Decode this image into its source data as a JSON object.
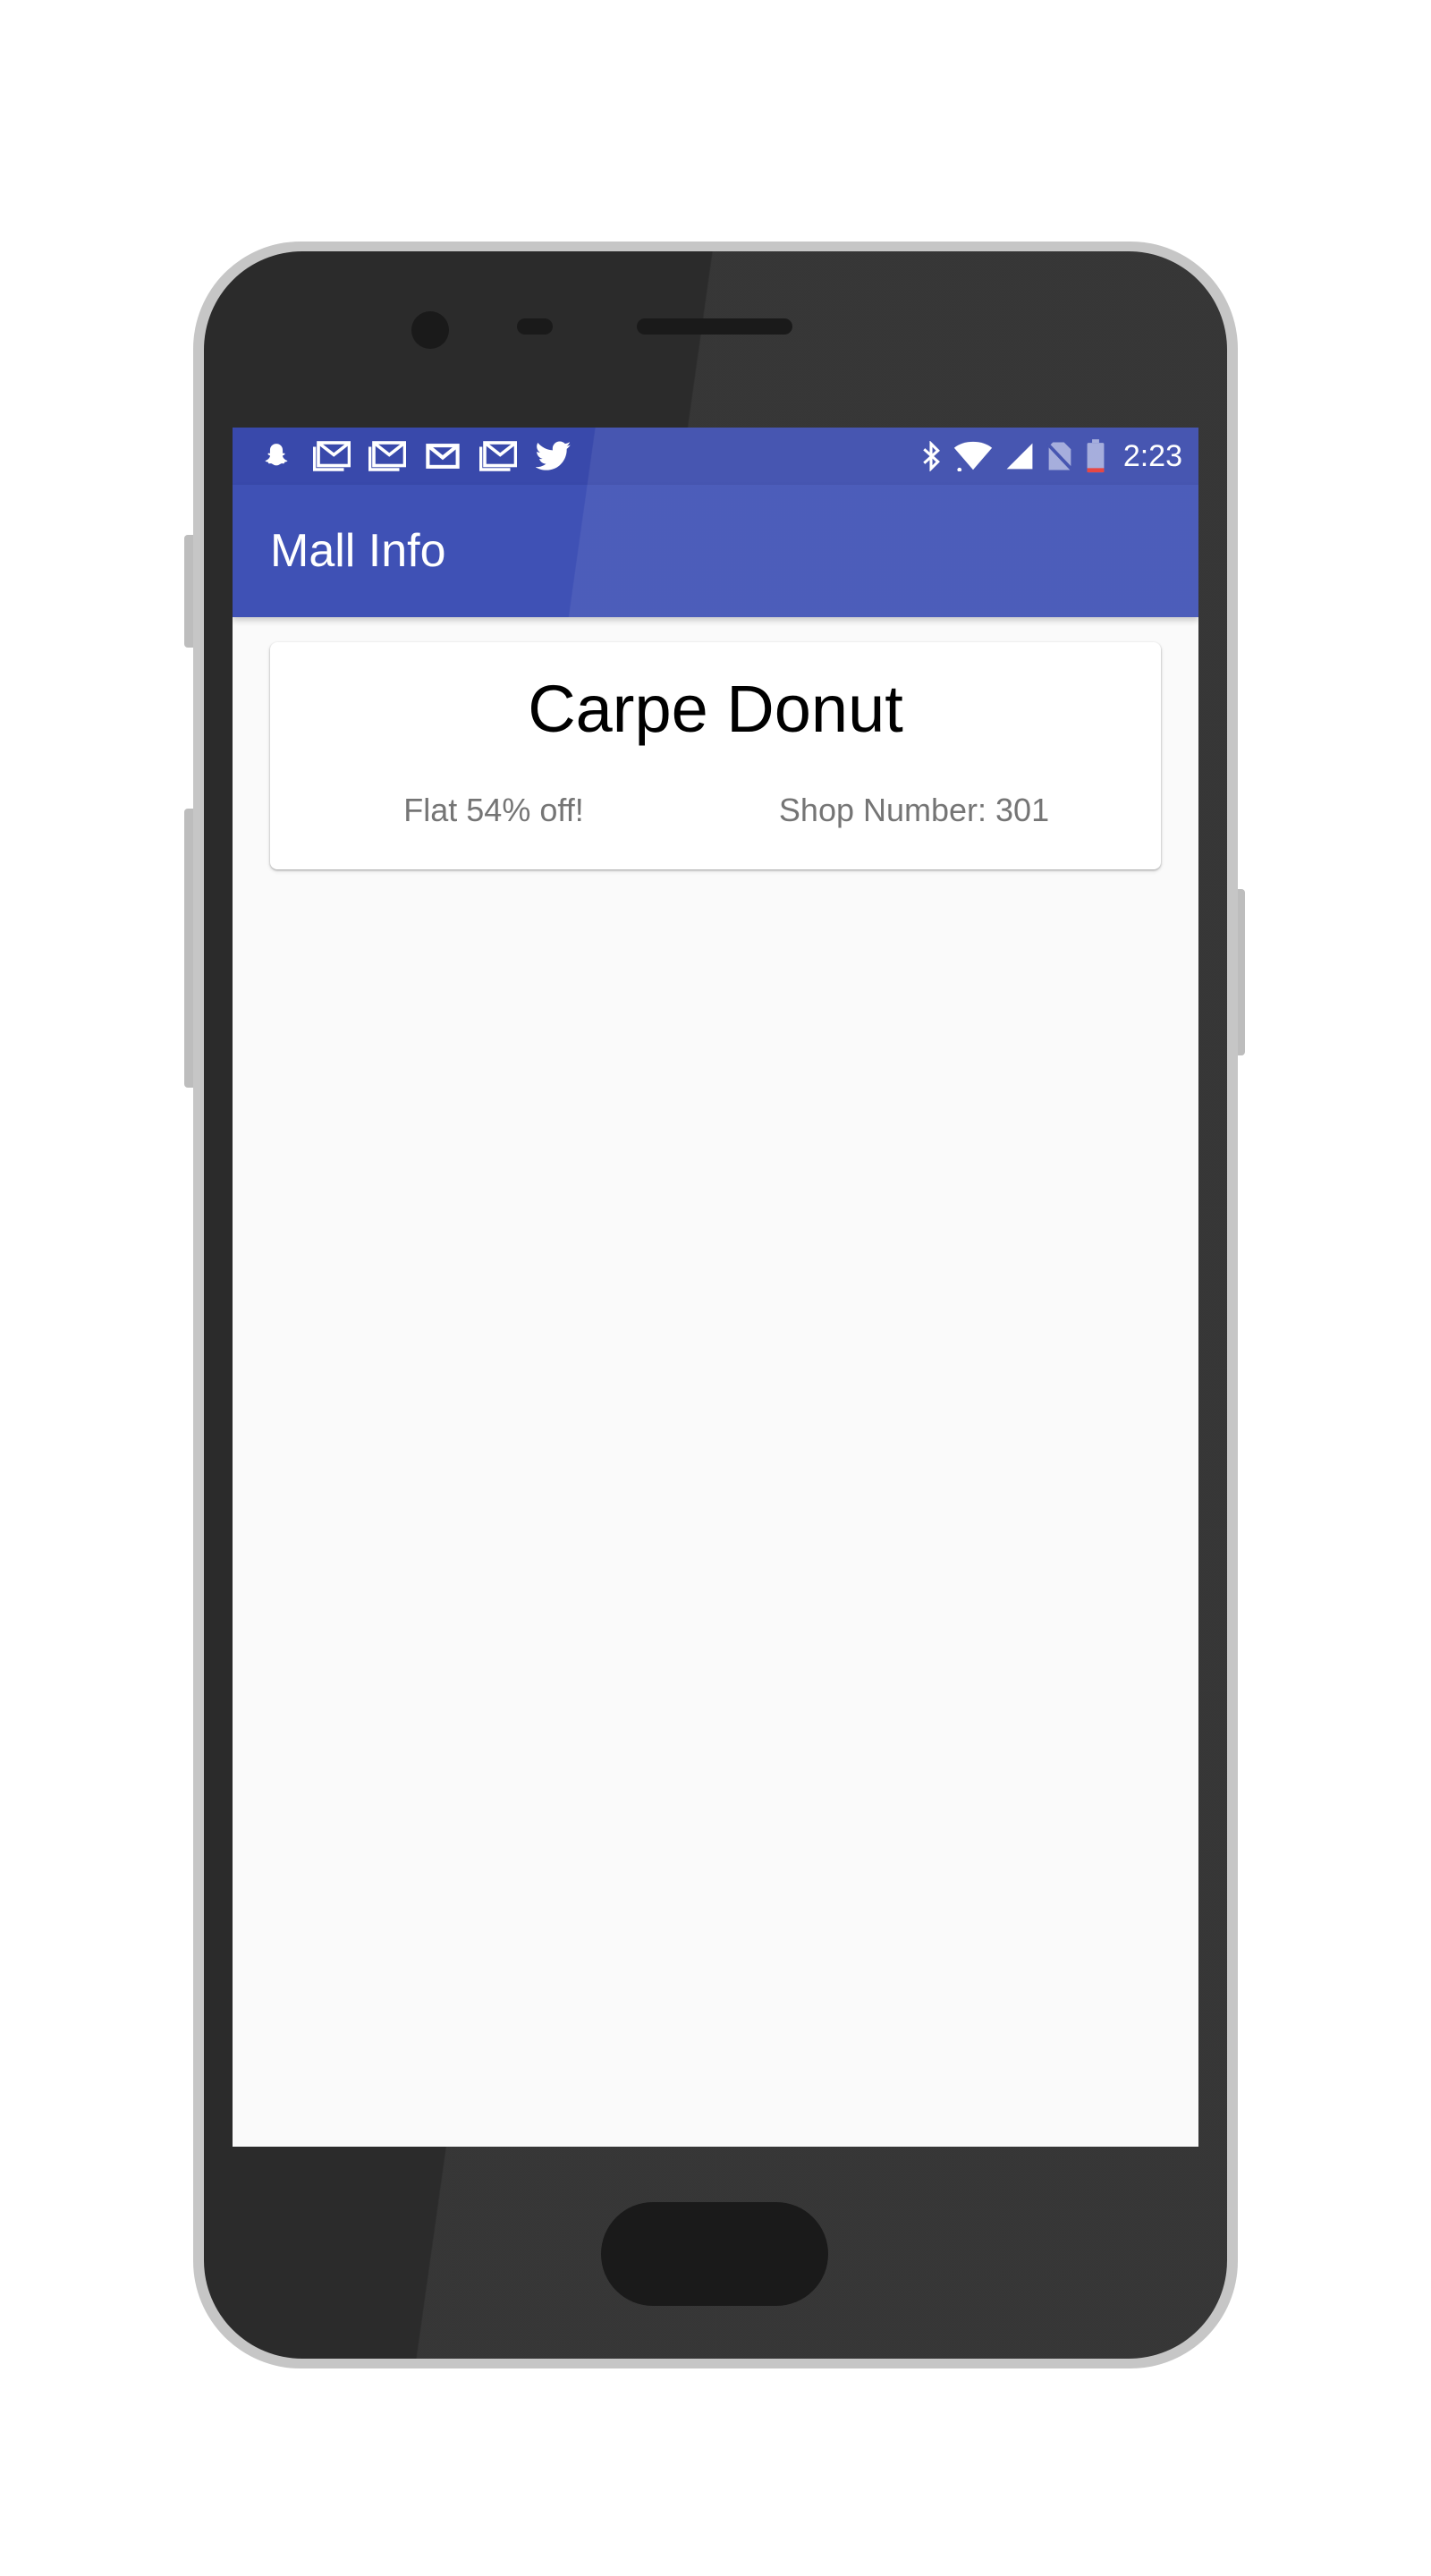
{
  "status_bar": {
    "time": "2:23",
    "notification_icons": [
      "snapchat-icon",
      "gmail-icon",
      "gmail-icon",
      "gmail-icon",
      "gmail-icon",
      "twitter-icon"
    ],
    "system_icons": [
      "bluetooth-icon",
      "wifi-icon",
      "signal-icon",
      "no-sim-icon",
      "battery-low-icon"
    ]
  },
  "app_bar": {
    "title": "Mall Info"
  },
  "shop_card": {
    "name": "Carpe Donut",
    "offer": "Flat 54% off!",
    "shop_number": "Shop Number: 301"
  },
  "colors": {
    "status_bar": "#3949ab",
    "app_bar": "#3f51b5",
    "background": "#fafafa",
    "card": "#ffffff",
    "secondary_text": "#757575",
    "battery_low": "#e53935"
  }
}
